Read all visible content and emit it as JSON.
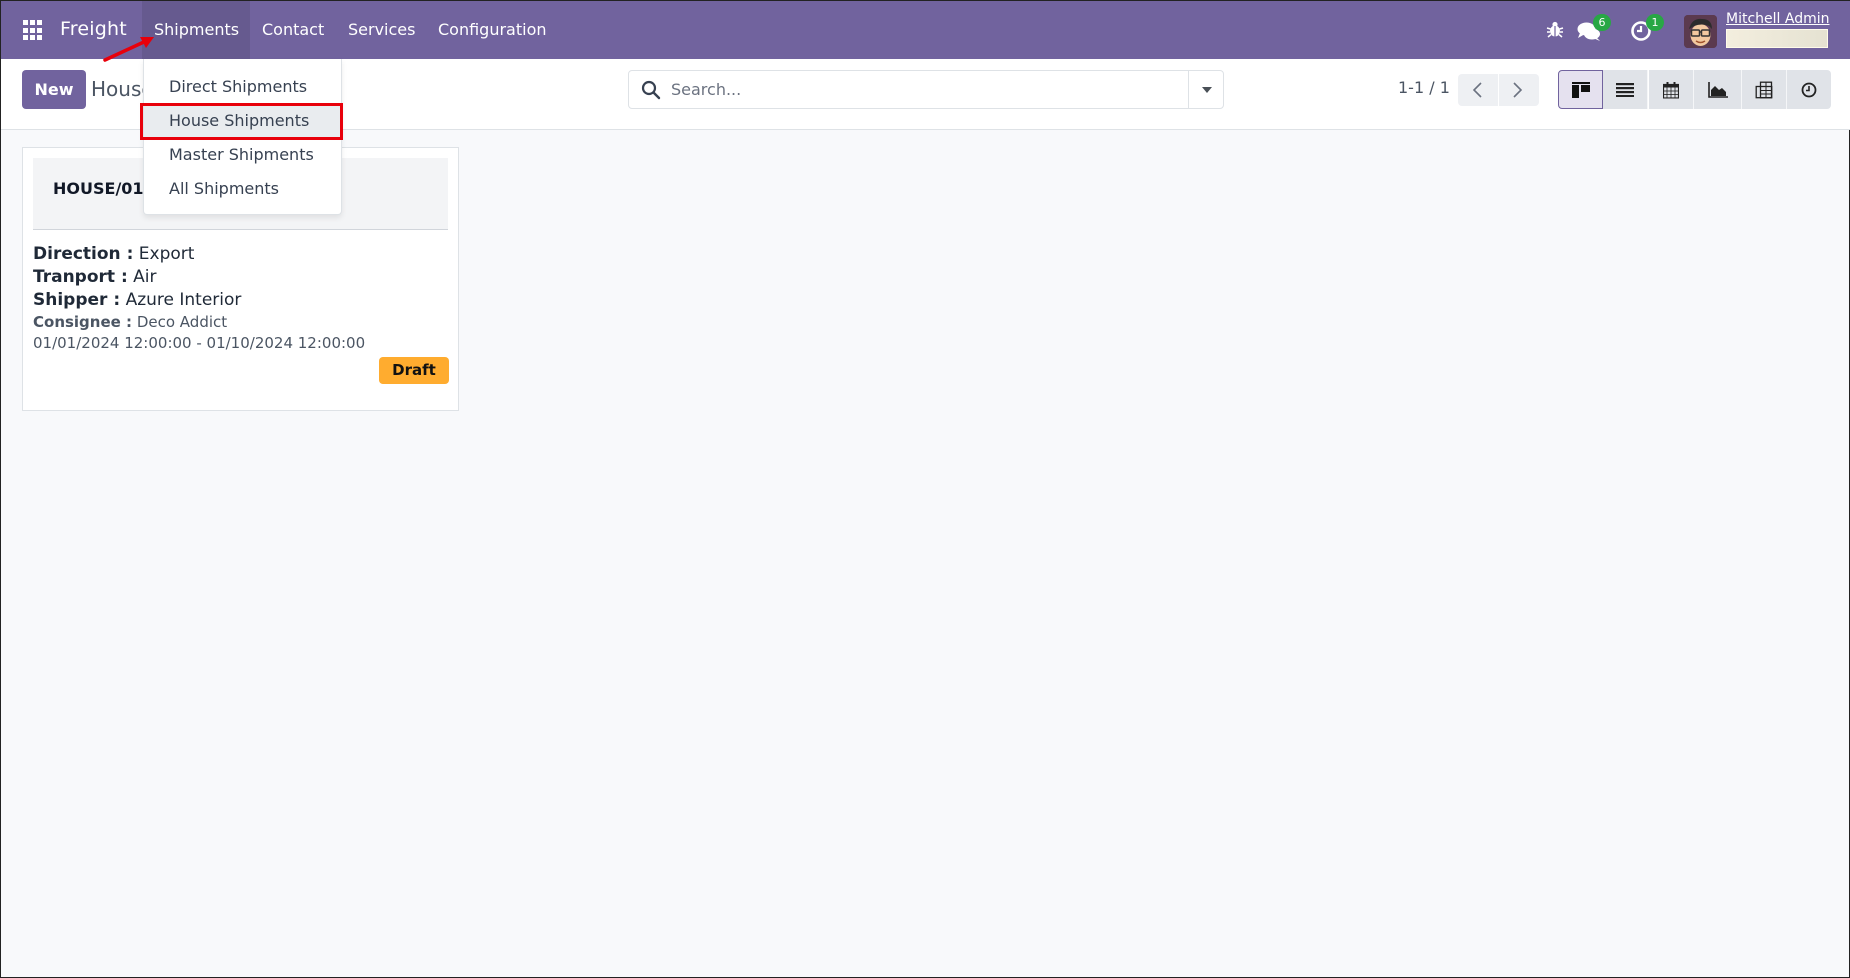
{
  "navbar": {
    "app_name": "Freight",
    "apps_icon": "apps-grid-icon",
    "menu": [
      {
        "label": "Shipments",
        "active": true
      },
      {
        "label": "Contact",
        "active": false
      },
      {
        "label": "Services",
        "active": false
      },
      {
        "label": "Configuration",
        "active": false
      }
    ],
    "systray": {
      "debug_icon": "bug-icon",
      "messages_icon": "chat-icon",
      "messages_count": "6",
      "activities_icon": "clock-icon",
      "activities_count": "1"
    },
    "user": {
      "name": "Mitchell Admin",
      "avatar": "avatar-icon"
    },
    "colors": {
      "brand": "#71639e",
      "badge": "#28a745"
    }
  },
  "control_panel": {
    "new_label": "New",
    "breadcrumb": "House",
    "search": {
      "placeholder": "Search...",
      "value": ""
    },
    "pager": {
      "value": "1-1 / 1"
    },
    "views": [
      {
        "name": "kanban",
        "icon": "kanban-icon",
        "active": true
      },
      {
        "name": "list",
        "icon": "list-icon",
        "active": false
      },
      {
        "name": "calendar",
        "icon": "calendar-icon",
        "active": false
      },
      {
        "name": "graph",
        "icon": "area-chart-icon",
        "active": false
      },
      {
        "name": "pivot",
        "icon": "pivot-table-icon",
        "active": false
      },
      {
        "name": "activity",
        "icon": "clock-icon",
        "active": false
      }
    ]
  },
  "dropdown": {
    "items": [
      {
        "label": "Direct Shipments"
      },
      {
        "label": "House Shipments",
        "highlighted": true
      },
      {
        "label": "Master Shipments"
      },
      {
        "label": "All Shipments"
      }
    ]
  },
  "kanban": {
    "cards": [
      {
        "title": "HOUSE/01/",
        "direction_label": "Direction :",
        "direction": "Export",
        "transport_label": "Tranport :",
        "transport": "Air",
        "shipper_label": "Shipper :",
        "shipper": "Azure Interior",
        "consignee_label": "Consignee :",
        "consignee": "Deco Addict",
        "date_range": "01/01/2024 12:00:00 - 01/10/2024 12:00:00",
        "status": "Draft",
        "status_color": "#ffac2f"
      }
    ]
  }
}
